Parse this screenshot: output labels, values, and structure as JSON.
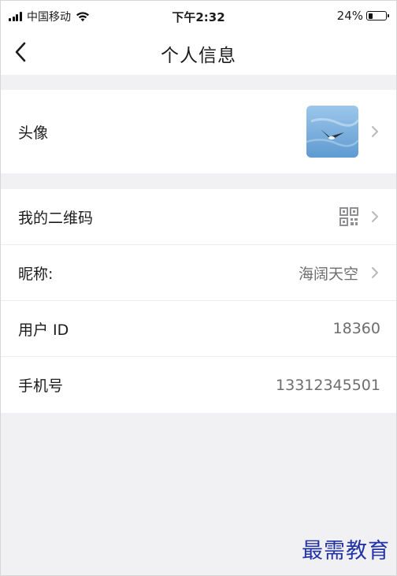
{
  "status_bar": {
    "carrier": "中国移动",
    "time": "下午2:32",
    "battery_percent": "24%",
    "battery_level": 0.24,
    "icons": [
      "signal-icon",
      "wifi-icon",
      "battery-icon"
    ]
  },
  "nav": {
    "back_icon": "chevron-left-icon",
    "title": "个人信息"
  },
  "profile": {
    "avatar_label": "头像",
    "qr_label": "我的二维码",
    "nickname_label": "昵称:",
    "nickname_value": "海阔天空",
    "userid_label": "用户 ID",
    "userid_value": "18360",
    "phone_label": "手机号",
    "phone_value": "13312345501"
  },
  "watermark": "最需教育",
  "colors": {
    "background": "#f1f1f3",
    "row_background": "#ffffff",
    "value_text": "#6e6e6e",
    "chevron": "#b8b8bd",
    "watermark": "#2233a8"
  }
}
